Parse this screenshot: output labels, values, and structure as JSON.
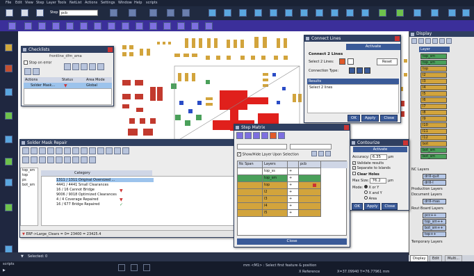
{
  "menubar": [
    "File",
    "Edit",
    "View",
    "Step",
    "Layer",
    "Tools",
    "NetList",
    "Actions",
    "Settings",
    "Window",
    "Help",
    "scripts"
  ],
  "toolbar": {
    "step_label": "Step",
    "step_value": "pcb"
  },
  "checklists": {
    "title": "Checklists",
    "frontline_label": "frontline_dfm_ama",
    "stop_on_error": "Stop on error",
    "columns": [
      "Actions",
      "Status",
      "Area Mode"
    ],
    "row": {
      "action": "Solder Mask...",
      "area_mode": "Global"
    }
  },
  "connect_lines": {
    "title": "Connect Lines",
    "activate": "Activate",
    "header": "Connect 2 Lines",
    "select_label": "Select 2 Lines:",
    "reset": "Reset",
    "connection_type": "Connection Type:",
    "results_label": "Results",
    "results_text": "Select 2 lines",
    "ok": "OK",
    "apply": "Apply",
    "close": "Close"
  },
  "display": {
    "title": "Display",
    "layer_header": "Layer",
    "layers": [
      "top_sm",
      "top_sm",
      "top",
      "l2",
      "l3",
      "l4",
      "l5",
      "l6",
      "l7",
      "l8",
      "l9",
      "l10",
      "l11",
      "l12",
      "bot",
      "bot_sm",
      "bot_sm"
    ],
    "sections": [
      "NC Layers",
      "Production Layers",
      "Document Layers",
      "Rout Board Layers",
      "Temporary Layers"
    ],
    "drill_layers": [
      "drill-quit",
      "drill-l",
      "drill-mas"
    ],
    "rout_layers": [
      "pcc++",
      "top_sm++",
      "bot_sm++",
      "top++"
    ],
    "tabs": [
      "Display",
      "Edit",
      "Multi..."
    ]
  },
  "solder_mask_repair": {
    "title": "Solder Mask Repair",
    "layers": [
      "top_sm",
      "top",
      "ps",
      "bot_sm"
    ],
    "category_header": "Category",
    "rows": [
      {
        "count": "1311 / 1311",
        "text": "Original Oversized ..."
      },
      {
        "count": "4441 / 4441",
        "text": "Small   Clearances"
      },
      {
        "count": "16 / 16",
        "text": "Cannot Bridge"
      },
      {
        "count": "9006 / 9018",
        "text": "Optimized Clearances"
      },
      {
        "count": "4 / 4",
        "text": "Coverage Repaired"
      },
      {
        "count": "16 / 677",
        "text": "Bridge Repaired"
      }
    ],
    "status": "ERF->Large_Clears = 0= 23400 = 23425.4"
  },
  "step_matrix": {
    "title": "Step Matrix",
    "show_hide": "Show/Hide Layer Upon Selection",
    "columns": [
      "Nc Span",
      "Layers",
      "",
      "pcb"
    ],
    "rows": [
      "top_ss",
      "top_sm",
      "top",
      "l2",
      "l3",
      "l4",
      "l5"
    ],
    "close": "Close"
  },
  "contourize": {
    "title": "Contourize",
    "activate": "Activate",
    "accuracy_label": "Accuracy:",
    "accuracy_value": "6.35",
    "unit": "µm",
    "validate": "Validate results",
    "separate": "Separate to Islands",
    "clear_holes": "Clear Holes",
    "max_size_label": "Max Size:",
    "max_size_value": "76.2",
    "mode_label": "Mode:",
    "modes": [
      "X or Y",
      "X and Y",
      "Area"
    ],
    "ok": "OK",
    "apply": "Apply",
    "close": "Close"
  },
  "status": {
    "selected": "Selected: 0",
    "scripts": "scripts",
    "message": "mm <M1> : Select first feature & position",
    "reference": "X Reference",
    "coords": "X=37.09940 Y=76.77961 mm"
  },
  "colors": {
    "titlebar": "#2f3f60",
    "accent": "#3a5a98",
    "board_layer": "#d2a43c",
    "mask_layer": "#4aa05a",
    "highlight_row": "#9cc3ec"
  }
}
